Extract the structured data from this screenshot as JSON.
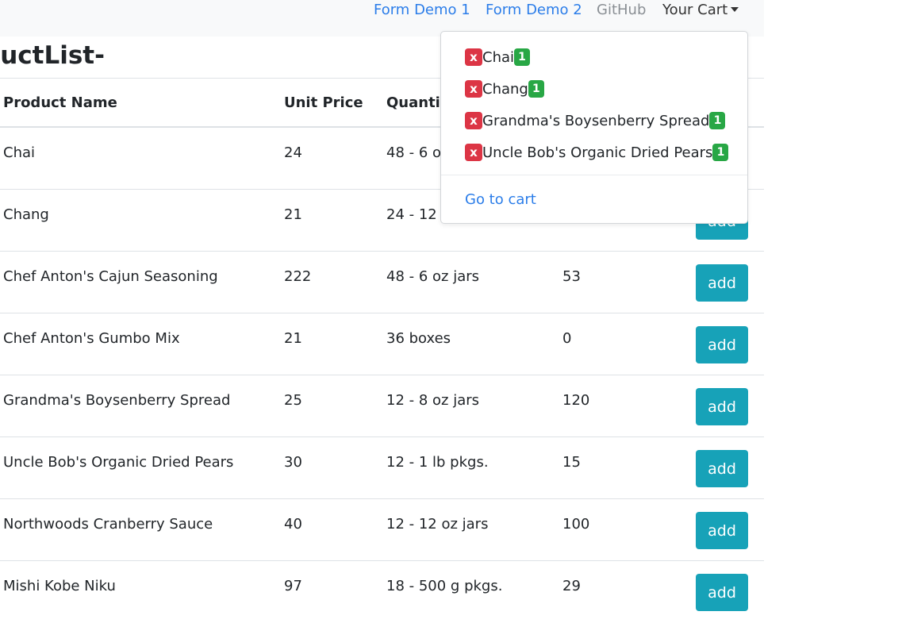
{
  "nav": {
    "form_demo_1": "Form Demo 1",
    "form_demo_2": "Form Demo 2",
    "github": "GitHub",
    "your_cart": "Your Cart"
  },
  "page": {
    "title": "ductList-"
  },
  "table": {
    "headers": [
      "Product Name",
      "Unit Price",
      "Quantit",
      ""
    ],
    "rows": [
      {
        "name": "Chai",
        "price": "24",
        "qty": "48 - 6 o",
        "stock": "",
        "button": ""
      },
      {
        "name": "Chang",
        "price": "21",
        "qty": "24 - 12",
        "stock": "",
        "button": "add"
      },
      {
        "name": "Chef Anton's Cajun Seasoning",
        "price": "222",
        "qty": "48 - 6 oz jars",
        "stock": "53",
        "button": "add"
      },
      {
        "name": "Chef Anton's Gumbo Mix",
        "price": "21",
        "qty": "36 boxes",
        "stock": "0",
        "button": "add"
      },
      {
        "name": "Grandma's Boysenberry Spread",
        "price": "25",
        "qty": "12 - 8 oz jars",
        "stock": "120",
        "button": "add"
      },
      {
        "name": "Uncle Bob's Organic Dried Pears",
        "price": "30",
        "qty": "12 - 1 lb pkgs.",
        "stock": "15",
        "button": "add"
      },
      {
        "name": "Northwoods Cranberry Sauce",
        "price": "40",
        "qty": "12 - 12 oz jars",
        "stock": "100",
        "button": "add"
      },
      {
        "name": "Mishi Kobe Niku",
        "price": "97",
        "qty": "18 - 500 g pkgs.",
        "stock": "29",
        "button": "add"
      }
    ]
  },
  "cart": {
    "items": [
      {
        "remove": "x",
        "name": "Chai",
        "count": "1"
      },
      {
        "remove": "x",
        "name": "Chang",
        "count": "1"
      },
      {
        "remove": "x",
        "name": "Grandma's Boysenberry Spread",
        "count": "1"
      },
      {
        "remove": "x",
        "name": "Uncle Bob's Organic Dried Pears",
        "count": "1"
      }
    ],
    "go_to_cart": "Go to cart"
  },
  "colors": {
    "link": "#2b7de9",
    "add_button": "#17a2b8",
    "remove_badge": "#dc3545",
    "qty_badge": "#28a745",
    "navbar_bg": "#f8f9fa"
  },
  "icons": {
    "cart_toggle": "caret-down-icon"
  }
}
